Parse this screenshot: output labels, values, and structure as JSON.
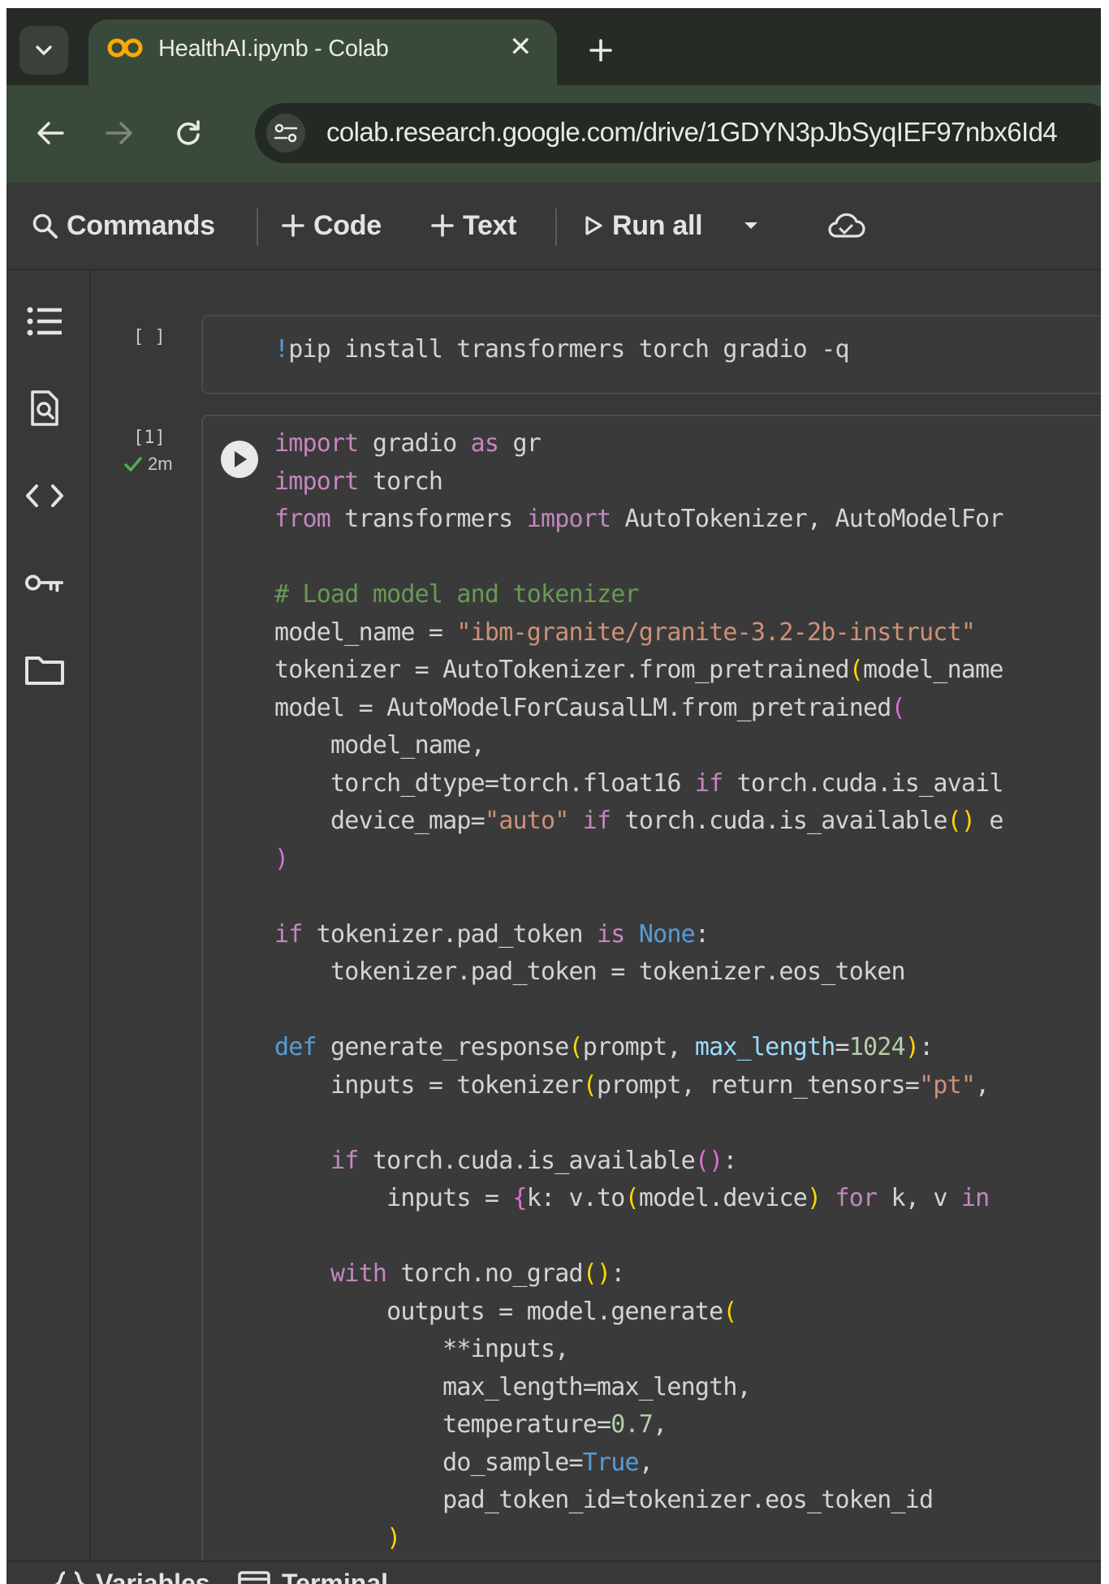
{
  "browser": {
    "tab_title": "HealthAI.ipynb - Colab",
    "tab_close_glyph": "✕",
    "url": "colab.research.google.com/drive/1GDYN3pJbSyqIEF97nbx6Id4",
    "icons": [
      "chevron-down-icon",
      "colab-logo-icon",
      "close-icon",
      "plus-icon",
      "back-arrow-icon",
      "forward-arrow-icon",
      "reload-icon",
      "site-info-icon"
    ]
  },
  "toolbar": {
    "commands_label": "Commands",
    "code_label": "Code",
    "text_label": "Text",
    "run_all_label": "Run all",
    "icons": [
      "search-icon",
      "plus-icon",
      "play-icon",
      "caret-down-icon",
      "cloud-icon"
    ]
  },
  "sidebar": {
    "items": [
      {
        "name": "table-of-contents",
        "icon": "list-icon"
      },
      {
        "name": "find-and-replace",
        "icon": "search-file-icon"
      },
      {
        "name": "code-snippets",
        "icon": "code-brackets-icon"
      },
      {
        "name": "secrets",
        "icon": "key-icon"
      },
      {
        "name": "files",
        "icon": "folder-icon"
      }
    ]
  },
  "cells": [
    {
      "exec_count": "[ ]",
      "source": "!pip install transformers torch gradio -q"
    },
    {
      "exec_count": "[1]",
      "status_time": "2m",
      "status": "completed",
      "source": [
        "import gradio as gr",
        "import torch",
        "from transformers import AutoTokenizer, AutoModelFor",
        "",
        "# Load model and tokenizer",
        "model_name = \"ibm-granite/granite-3.2-2b-instruct\"",
        "tokenizer = AutoTokenizer.from_pretrained(model_name",
        "model = AutoModelForCausalLM.from_pretrained(",
        "    model_name,",
        "    torch_dtype=torch.float16 if torch.cuda.is_avail",
        "    device_map=\"auto\" if torch.cuda.is_available() e",
        ")",
        "",
        "if tokenizer.pad_token is None:",
        "    tokenizer.pad_token = tokenizer.eos_token",
        "",
        "def generate_response(prompt, max_length=1024):",
        "    inputs = tokenizer(prompt, return_tensors=\"pt\",",
        "",
        "    if torch.cuda.is_available():",
        "        inputs = {k: v.to(model.device) for k, v in",
        "",
        "    with torch.no_grad():",
        "        outputs = model.generate(",
        "            **inputs,",
        "            max_length=max_length,",
        "            temperature=0.7,",
        "            do_sample=True,",
        "            pad_token_id=tokenizer.eos_token_id",
        "        )"
      ]
    }
  ],
  "bottom_bar": {
    "variables_label": "Variables",
    "terminal_label": "Terminal"
  },
  "colors": {
    "keyword": "#c586c0",
    "builtin": "#569cd6",
    "string": "#ce9178",
    "comment": "#6a9955",
    "param": "#9cdcfe",
    "number": "#b5cea8",
    "bracket": "#ffd700",
    "status_ok": "#4caf50",
    "colab_orange": "#f9ab00"
  }
}
